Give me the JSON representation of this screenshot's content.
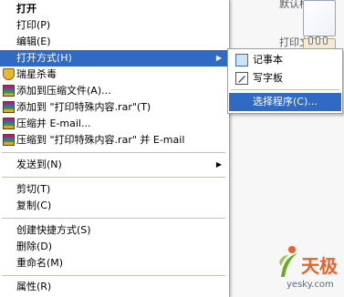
{
  "desktop": {
    "label_top": "默认样品",
    "label_second": "打印文件"
  },
  "context_menu": {
    "items": [
      {
        "label": "打开",
        "bold": true
      },
      {
        "label": "打印(P)"
      },
      {
        "label": "编辑(E)"
      },
      {
        "label": "打开方式(H)",
        "highlighted": true,
        "has_submenu": true
      },
      {
        "label": "瑞星杀毒",
        "icon": "shield-icon"
      },
      {
        "label": "添加到压缩文件(A)...",
        "icon": "winrar-icon"
      },
      {
        "label": "添加到 \"打印特殊内容.rar\"(T)",
        "icon": "winrar-icon"
      },
      {
        "label": "压缩并 E-mail...",
        "icon": "winrar-icon"
      },
      {
        "label": "压缩到 \"打印特殊内容.rar\" 并 E-mail",
        "icon": "winrar-icon"
      },
      {
        "label": "发送到(N)",
        "has_submenu": true
      },
      {
        "label": "剪切(T)"
      },
      {
        "label": "复制(C)"
      },
      {
        "label": "创建快捷方式(S)"
      },
      {
        "label": "删除(D)"
      },
      {
        "label": "重命名(M)"
      },
      {
        "label": "属性(R)"
      }
    ]
  },
  "open_with_submenu": {
    "items": [
      {
        "label": "记事本",
        "icon": "notepad-icon"
      },
      {
        "label": "写字板",
        "icon": "wordpad-icon"
      },
      {
        "label": "选择程序(C)...",
        "highlighted": true
      }
    ]
  },
  "watermark": {
    "brand": "天极",
    "url": "yesky.com"
  },
  "colors": {
    "highlight": "#316ac5",
    "menu_bg": "#ffffff",
    "separator": "#c5c2b2",
    "brand": "#e8622a"
  }
}
